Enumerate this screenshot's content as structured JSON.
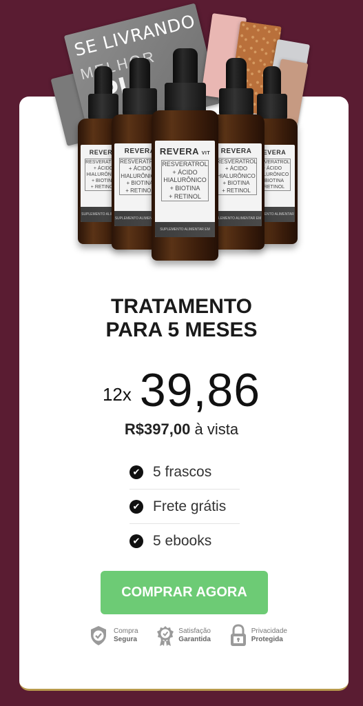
{
  "hero": {
    "ebook_title": "SE LIVRANDO DA",
    "ebook_word_1": "MELHOR",
    "ebook_word_2": "PL",
    "bottle_brand": "REVERA",
    "bottle_brand_sub": "VIT",
    "bottle_ingredients": [
      "RESVERATROL",
      "+ ÁCIDO",
      "HIALURÔNICO",
      "+ BIOTINA",
      "+ RETINOL"
    ],
    "bottle_footer": "SUPLEMENTO ALIMENTAR EM GOTAS"
  },
  "offer": {
    "title_line1": "TRATAMENTO",
    "title_line2": "PARA 5 MESES",
    "installments": "12x",
    "installment_price": "39,86",
    "cash_price": "R$397,00",
    "cash_label": "à vista",
    "features": [
      "5 frascos",
      "Frete grátis",
      "5 ebooks"
    ],
    "cta_label": "COMPRAR AGORA"
  },
  "badges": [
    {
      "line1": "Compra",
      "line2": "Segura",
      "icon": "shield-check-icon"
    },
    {
      "line1": "Satisfação",
      "line2": "Garantida",
      "icon": "medal-check-icon"
    },
    {
      "line1": "Privacidade",
      "line2": "Protegida",
      "icon": "lock-icon"
    }
  ],
  "colors": {
    "background": "#5a1c32",
    "card": "#ffffff",
    "cta": "#6dcb75",
    "accent_border": "#b89a4d"
  }
}
